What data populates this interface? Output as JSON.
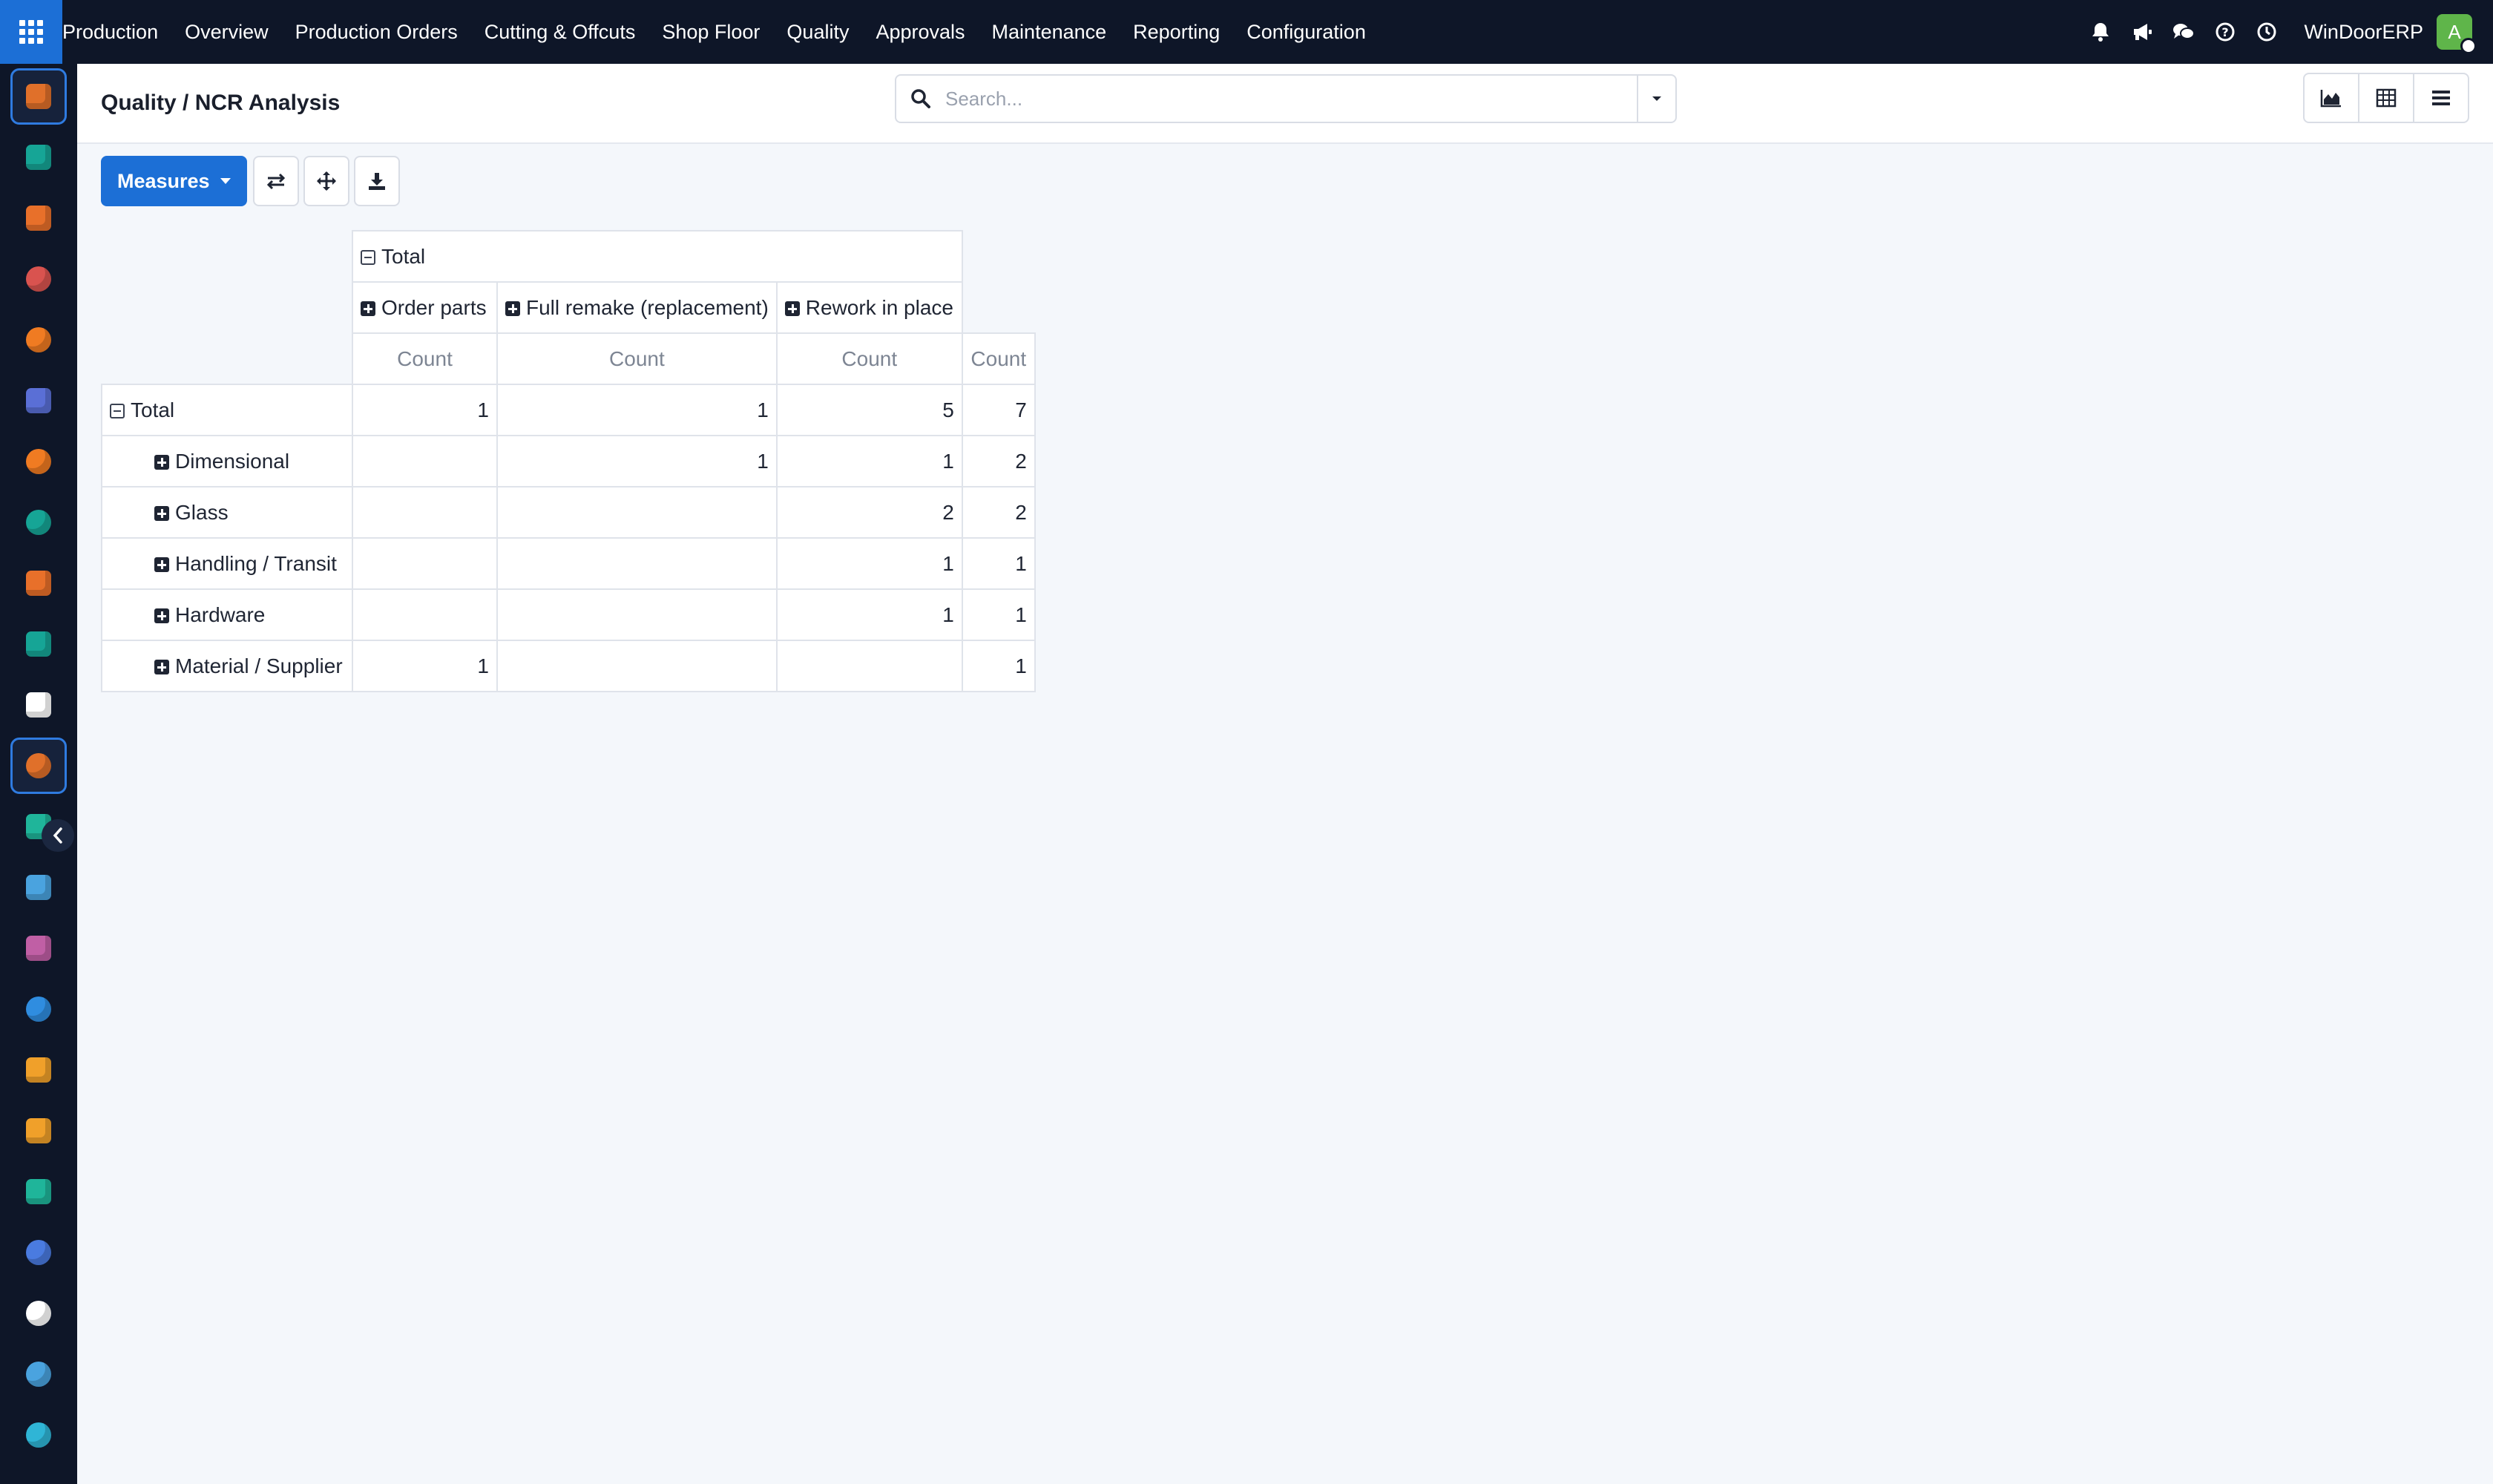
{
  "topbar": {
    "menu": [
      "Production",
      "Overview",
      "Production Orders",
      "Cutting & Offcuts",
      "Shop Floor",
      "Quality",
      "Approvals",
      "Maintenance",
      "Reporting",
      "Configuration"
    ],
    "company": "WinDoorERP",
    "avatar_initial": "A"
  },
  "sidebar": {
    "apps": [
      {
        "icon": "production-app-icon",
        "color": "#e0702a"
      },
      {
        "icon": "contacts-app-icon",
        "color": "#16a596"
      },
      {
        "icon": "reporting-app-icon",
        "color": "#e8702a"
      },
      {
        "icon": "pie-app-icon",
        "color": "#d9534f"
      },
      {
        "icon": "discuss-app-icon",
        "color": "#f07b22"
      },
      {
        "icon": "mail-app-icon",
        "color": "#5a6fd6"
      },
      {
        "icon": "chat-app-icon",
        "color": "#f07b22"
      },
      {
        "icon": "check-app-icon",
        "color": "#16a596"
      },
      {
        "icon": "bars-app-icon",
        "color": "#e8702a"
      },
      {
        "icon": "contacts-alt-app-icon",
        "color": "#16a596"
      },
      {
        "icon": "cube-app-icon",
        "color": "#ffffff"
      },
      {
        "icon": "production-active-app-icon",
        "color": "#e0702a"
      },
      {
        "icon": "tasks-app-icon",
        "color": "#1fb59a"
      },
      {
        "icon": "knowledge-app-icon",
        "color": "#4aa3df"
      },
      {
        "icon": "inventory-app-icon",
        "color": "#c05fa5"
      },
      {
        "icon": "invoicing-app-icon",
        "color": "#2f8de0"
      },
      {
        "icon": "employees-app-icon",
        "color": "#f0a02a"
      },
      {
        "icon": "calendar-app-icon",
        "color": "#f0a02a"
      },
      {
        "icon": "sign-app-icon",
        "color": "#1fb59a"
      },
      {
        "icon": "dashboards-app-icon",
        "color": "#4a7be0"
      },
      {
        "icon": "whatsapp-app-icon",
        "color": "#ffffff"
      },
      {
        "icon": "clock-app-icon",
        "color": "#4aa3df"
      },
      {
        "icon": "website-app-icon",
        "color": "#2fb5d6"
      }
    ]
  },
  "control": {
    "breadcrumb": "Quality / NCR Analysis",
    "search_placeholder": "Search..."
  },
  "toolbar": {
    "measures_label": "Measures"
  },
  "pivot": {
    "col_total": "Total",
    "col_groups": [
      "Order parts",
      "Full remake (replacement)",
      "Rework in place"
    ],
    "measure": "Count",
    "row_total": "Total",
    "total_row": [
      "1",
      "1",
      "5",
      "7"
    ],
    "rows": [
      {
        "label": "Dimensional",
        "cells": [
          "",
          "1",
          "1",
          "2"
        ]
      },
      {
        "label": "Glass",
        "cells": [
          "",
          "",
          "2",
          "2"
        ]
      },
      {
        "label": "Handling / Transit",
        "cells": [
          "",
          "",
          "1",
          "1"
        ]
      },
      {
        "label": "Hardware",
        "cells": [
          "",
          "",
          "1",
          "1"
        ]
      },
      {
        "label": "Material / Supplier",
        "cells": [
          "1",
          "",
          "",
          "1"
        ]
      }
    ]
  }
}
